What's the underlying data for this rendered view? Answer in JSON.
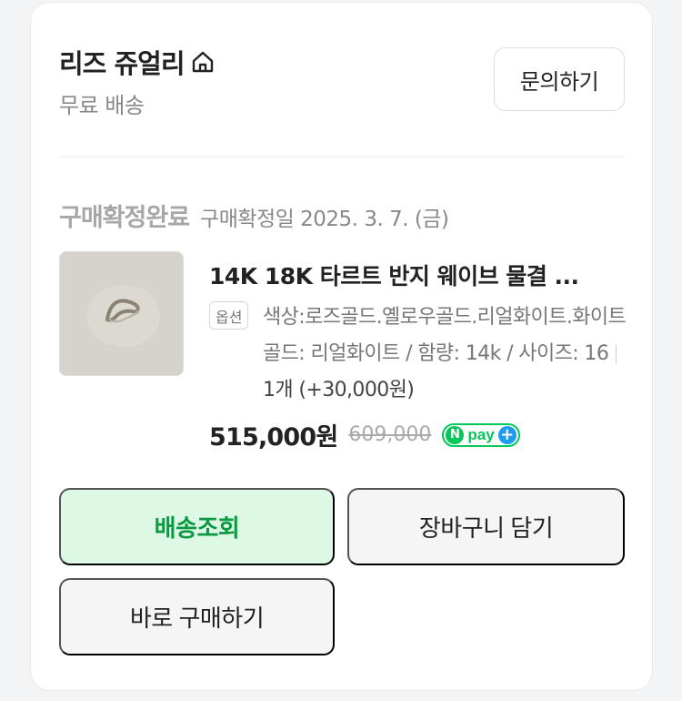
{
  "store": {
    "name": "리즈 쥬얼리",
    "shipping": "무료 배송",
    "inquiry_label": "문의하기"
  },
  "order": {
    "status": "구매확정완료",
    "confirm_date": "구매확정일 2025. 3. 7. (금)"
  },
  "product": {
    "title": "14K 18K 타르트 반지 웨이브 물결 ...",
    "option_tag": "옵션",
    "option_line": "색상:로즈골드.옐로우골드.리얼화이트.화이트골드: 리얼화이트 / 함량: 14k / 사이즈: 16",
    "quantity": "1개 (+30,000원)",
    "price": "515,000원",
    "original_price": "609,000",
    "npay_label": "pay"
  },
  "actions": {
    "track_label": "배송조회",
    "cart_label": "장바구니 담기",
    "buy_label": "바로 구매하기"
  },
  "colors": {
    "accent_green": "#03c75a",
    "track_bg": "#ddf9e6",
    "track_text": "#0a9a41"
  },
  "icons": {
    "store": "home-icon",
    "npay": "npay-plus-icon"
  }
}
